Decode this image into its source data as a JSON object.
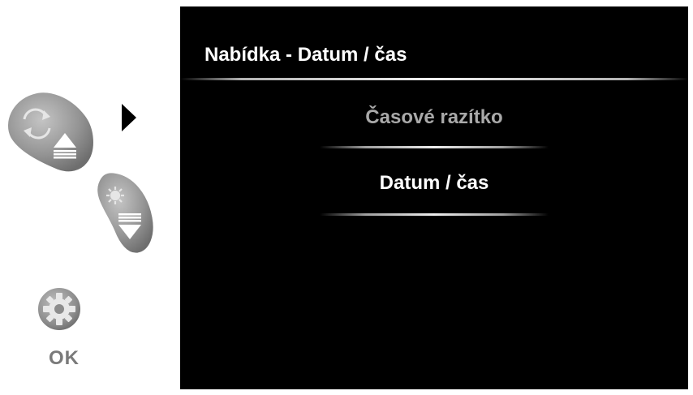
{
  "screen": {
    "title": "Nabídka - Datum / čas",
    "menu_items": [
      {
        "label": "Časové razítko",
        "state": "dimmed"
      },
      {
        "label": "Datum / čas",
        "state": "highlighted"
      }
    ]
  },
  "controls": {
    "buttons": [
      {
        "name": "up-button",
        "icons": [
          "rotate-icon",
          "up-arrow-icon"
        ]
      },
      {
        "name": "down-button",
        "icons": [
          "brightness-icon",
          "down-arrow-icon"
        ]
      },
      {
        "name": "ok-button",
        "icons": [
          "gear-icon"
        ]
      }
    ],
    "ok_label": "OK",
    "pointer_icon": "right-pointer-icon"
  },
  "colors": {
    "screen_background": "#000000",
    "screen_text": "#ffffff",
    "dimmed_text": "#a9a9a9",
    "button_gray": "#8a8a8a",
    "label_gray": "#7a7a7a"
  }
}
